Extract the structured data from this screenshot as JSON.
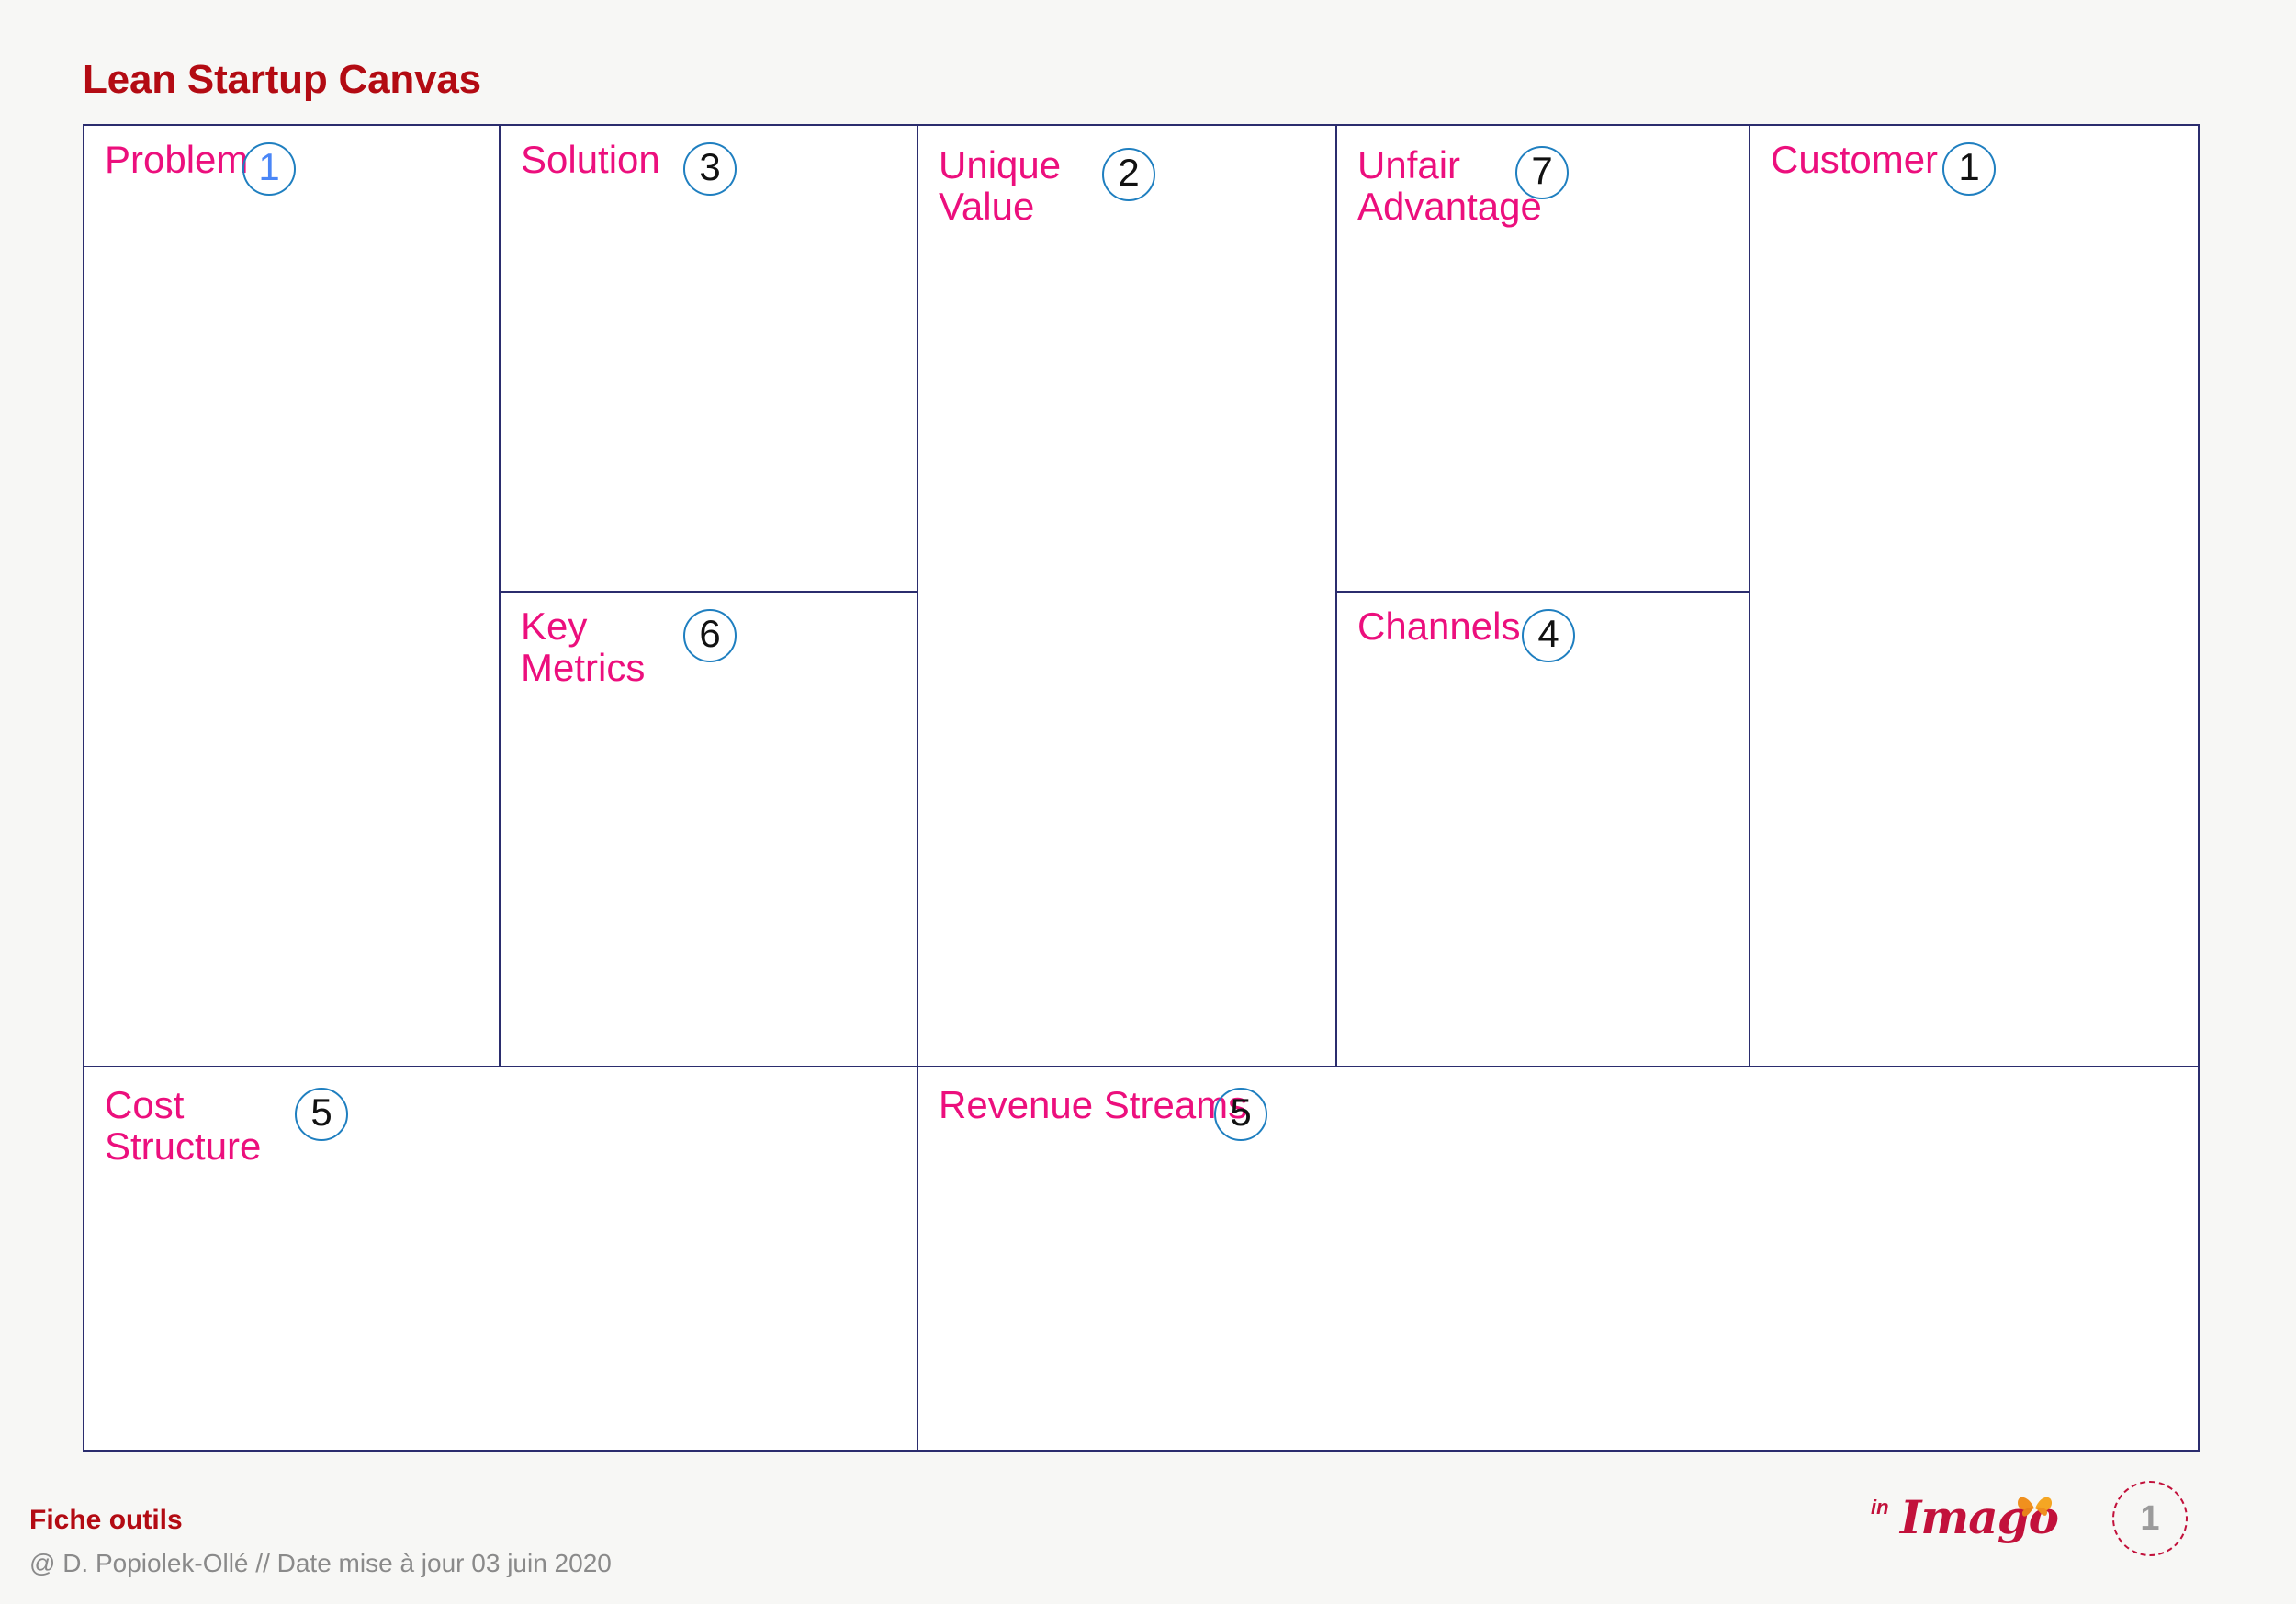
{
  "document": {
    "title": "Lean Startup Canvas"
  },
  "canvas": {
    "cells": [
      {
        "key": "problem",
        "label": "Problem",
        "badge": "1",
        "badge_color": "blue"
      },
      {
        "key": "solution",
        "label": "Solution",
        "badge": "3",
        "badge_color": "black"
      },
      {
        "key": "key_metrics",
        "label": "Key\nMetrics",
        "badge": "6",
        "badge_color": "black"
      },
      {
        "key": "unique_value",
        "label": "Unique\nValue",
        "badge": "2",
        "badge_color": "black"
      },
      {
        "key": "unfair_advantage",
        "label": "Unfair\nAdvantage",
        "badge": "7",
        "badge_color": "black"
      },
      {
        "key": "channels",
        "label": "Channels",
        "badge": "4",
        "badge_color": "black"
      },
      {
        "key": "customer",
        "label": "Customer",
        "badge": "1",
        "badge_color": "black"
      },
      {
        "key": "cost_structure",
        "label": "Cost\nStructure",
        "badge": "5",
        "badge_color": "black"
      },
      {
        "key": "revenue_streams",
        "label": "Revenue Streams",
        "badge": "5",
        "badge_color": "black"
      }
    ]
  },
  "footer": {
    "title": "Fiche outils",
    "credit": "@ D. Popiolek-Ollé // Date mise à jour 03 juin 2020",
    "logo_prefix": "in",
    "logo_word": "Imago",
    "page_number": "1"
  },
  "colors": {
    "title_red": "#b30b13",
    "label_magenta": "#ec0f7d",
    "grid_navy": "#2b2d6e",
    "badge_ring_blue": "#1f7fc0",
    "badge_blue_number": "#4a86f7",
    "background": "#f7f7f5",
    "logo_crimson": "#c2113b",
    "butterfly_orange": "#f0901e",
    "footer_grey": "#8a8a8a"
  }
}
